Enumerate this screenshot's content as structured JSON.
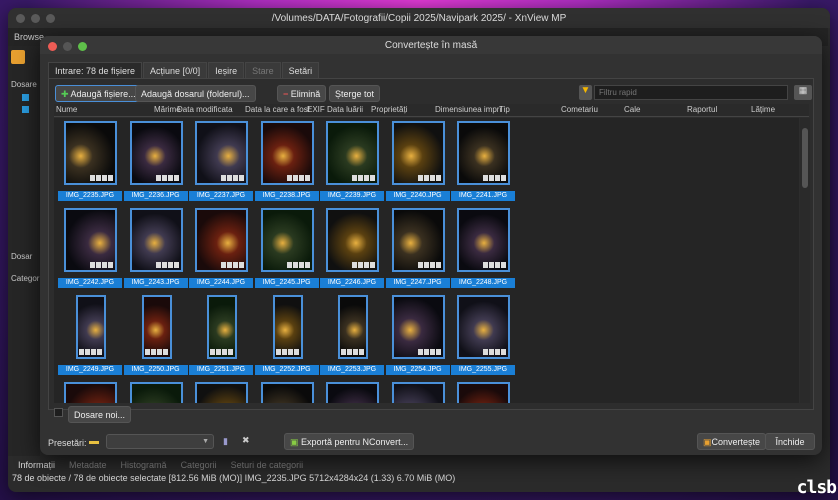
{
  "window": {
    "title": "/Volumes/DATA/Fotografii/Copii 2025/Navipark 2025/ - XnView MP",
    "browse_tab": "Browse"
  },
  "sidebar": {
    "folders": "Dosare",
    "folder2": "Dosar",
    "categories": "Categor"
  },
  "dialog": {
    "title": "Convertește în masă",
    "tabs": [
      {
        "label": "Intrare: 78 de fișiere"
      },
      {
        "label": "Acțiune [0/0]"
      },
      {
        "label": "Ieșire"
      },
      {
        "label": "Stare"
      },
      {
        "label": "Setări"
      }
    ],
    "toolbar": {
      "add_files": "Adaugă fișiere...",
      "add_folder": "Adaugă dosarul (folderul)...",
      "remove": "Elimină",
      "clear_all": "Șterge tot",
      "filter_placeholder": "Filtru rapid"
    },
    "columns": [
      "Nume",
      "Mărime",
      "Data modificata",
      "Data la care a fost",
      "EXIF Data luării",
      "Proprietăți",
      "Dimensiunea impri",
      "Tip",
      "Cometariu",
      "Cale",
      "Raportul",
      "Lățime"
    ],
    "files": [
      "IMG_2235.JPG",
      "IMG_2236.JPG",
      "IMG_2237.JPG",
      "IMG_2238.JPG",
      "IMG_2239.JPG",
      "IMG_2240.JPG",
      "IMG_2241.JPG",
      "IMG_2242.JPG",
      "IMG_2243.JPG",
      "IMG_2244.JPG",
      "IMG_2245.JPG",
      "IMG_2246.JPG",
      "IMG_2247.JPG",
      "IMG_2248.JPG",
      "IMG_2249.JPG",
      "IMG_2250.JPG",
      "IMG_2251.JPG",
      "IMG_2252.JPG",
      "IMG_2253.JPG",
      "IMG_2254.JPG",
      "IMG_2255.JPG"
    ],
    "new_folders": "Dosare noi...",
    "presets_label": "Presetări:",
    "export_nconvert": "Exportă pentru NConvert...",
    "convert": "Convertește",
    "close": "Închide"
  },
  "bottom_tabs": [
    "Informații",
    "Metadate",
    "Histogramă",
    "Categorii",
    "Seturi de categorii"
  ],
  "status": "78 de obiecte / 78 de obiecte selectate [812.56 MiB (MO)]  IMG_2235.JPG  5712x4284x24 (1.33)  6.70 MiB (MO)",
  "watermark": "clsb"
}
